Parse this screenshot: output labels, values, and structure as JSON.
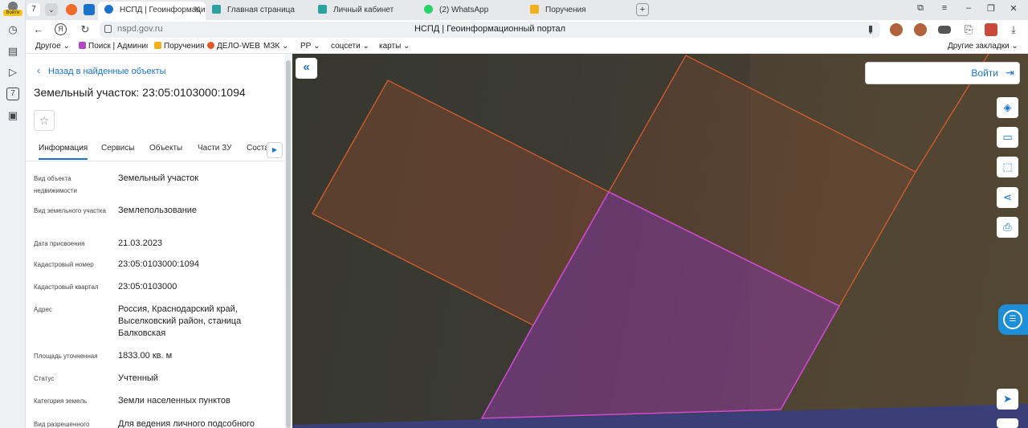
{
  "rail": {
    "profile_label": "Войти",
    "items": [
      "clock-icon",
      "notes-icon",
      "play-icon",
      "calendar-icon",
      "screenshot-icon"
    ],
    "calendar_day": "7"
  },
  "tabs": {
    "count": "7",
    "items": [
      {
        "label": "НСПД | Геоинформаци",
        "active": true,
        "color": "#1a73c8"
      },
      {
        "label": "Главная страница",
        "active": false,
        "color": "#2aa3a0"
      },
      {
        "label": "Личный кабинет",
        "active": false,
        "color": "#2aa3a0"
      },
      {
        "label": "(2) WhatsApp",
        "active": false,
        "color": "#25d366"
      },
      {
        "label": "Поручения",
        "active": false,
        "color": "#f2b01e"
      }
    ]
  },
  "nav": {
    "url": "nspd.gov.ru",
    "page_title": "НСПД | Геоинформационный портал"
  },
  "bookmarks": [
    {
      "label": "Другое ⌄",
      "color": ""
    },
    {
      "label": "Поиск | Админис",
      "color": "#b04ac0"
    },
    {
      "label": "Поручения",
      "color": "#f2b01e"
    },
    {
      "label": "ДЕЛО-WEB",
      "color": "#e05a2a"
    },
    {
      "label": "МЗК ⌄",
      "color": ""
    },
    {
      "label": "РР ⌄",
      "color": ""
    },
    {
      "label": "соцсети ⌄",
      "color": ""
    },
    {
      "label": "карты ⌄",
      "color": ""
    }
  ],
  "other_bookmarks": "Другие закладки ⌄",
  "panel": {
    "back_label": "Назад в найденные объекты",
    "title": "Земельный участок: 23:05:0103000:1094",
    "tabs": [
      "Информация",
      "Сервисы",
      "Объекты",
      "Части ЗУ",
      "Соста"
    ],
    "properties": [
      {
        "key": "Вид объекта недвижимости",
        "value": "Земельный участок"
      },
      {
        "key": "Вид земельного участка",
        "value": "Землепользование"
      },
      {
        "key": "Дата присвоения",
        "value": "21.03.2023"
      },
      {
        "key": "Кадастровый номер",
        "value": "23:05:0103000:1094"
      },
      {
        "key": "Кадастровый квартал",
        "value": "23:05:0103000"
      },
      {
        "key": "Адрес",
        "value": "Россия, Краснодарский край, Выселковский район, станица Балковская"
      },
      {
        "key": "Площадь уточненная",
        "value": "1833.00 кв. м"
      },
      {
        "key": "Статус",
        "value": "Учтенный"
      },
      {
        "key": "Категория земель",
        "value": "Земли населенных пунктов"
      },
      {
        "key": "Вид разрешенного",
        "value": "Для ведения личного подсобного"
      }
    ]
  },
  "map": {
    "login_label": "Войти",
    "tools": [
      "layers-icon",
      "ruler-icon",
      "select-area-icon",
      "share-icon",
      "print-icon",
      "send-icon"
    ]
  }
}
